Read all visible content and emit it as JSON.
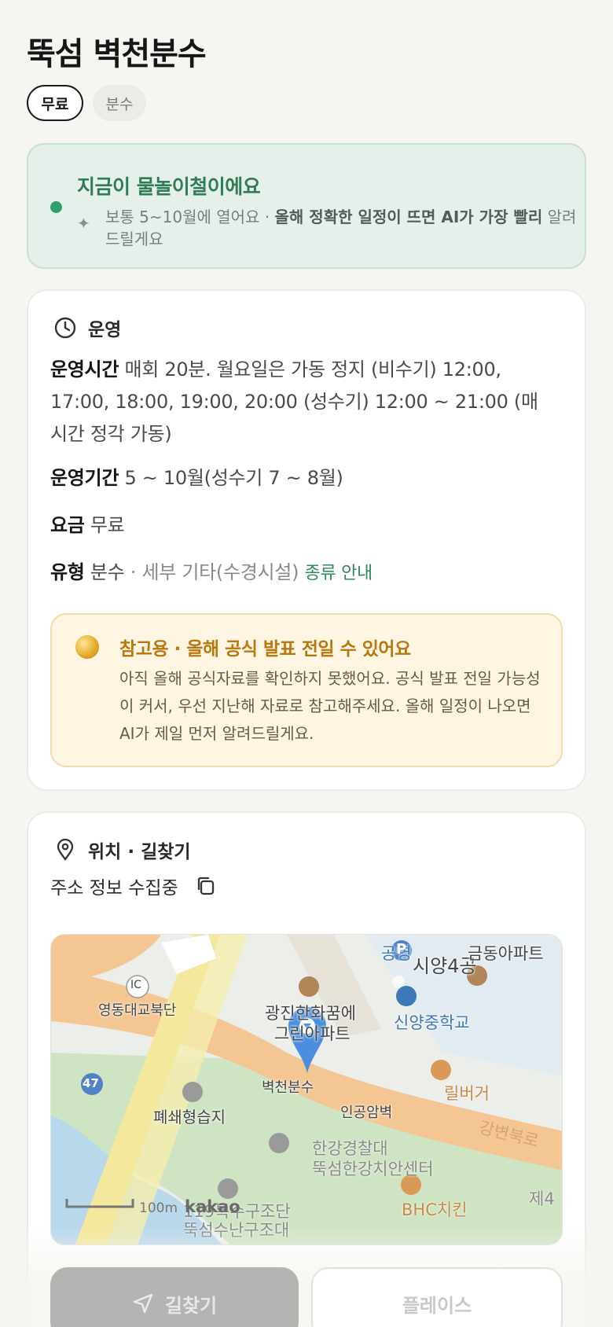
{
  "page": {
    "title": "뚝섬 벽천분수"
  },
  "chips": [
    {
      "label": "무료",
      "selected": true
    },
    {
      "label": "분수",
      "selected": false
    }
  ],
  "season": {
    "heading": "지금이 물놀이철이에요",
    "note_prefix": "보통 5~10월에 열어요 · ",
    "note_bold": "올해 정확한 일정이 뜨면 AI가 가장 빨리",
    "note_suffix": " 알려드릴게요",
    "accent": "#2ea06a"
  },
  "ops": {
    "heading": "운영",
    "hours_key": "운영시간",
    "hours_value": "매회 20분. 월요일은 가동 정지 (비수기) 12:00, 17:00, 18:00, 19:00, 20:00 (성수기) 12:00 ~ 21:00 (매시간 정각 가동)",
    "period_key": "운영기간",
    "period_value": "5 ~ 10월(성수기 7 ~ 8월)",
    "fee_key": "요금",
    "fee_value": "무료",
    "type_key": "유형",
    "type_value": "분수",
    "type_sub": " · 세부 기타(수경시설)",
    "type_link": "종류 안내",
    "notice_heading": "참고용 · 올해 공식 발표 전일 수 있어요",
    "notice_body": "아직 올해 공식자료를 확인하지 못했어요. 공식 발표 전일 가능성이 커서, 우선 지난해 자료로 참고해주세요. 올해 일정이 나오면 AI가 제일 먼저 알려드릴게요."
  },
  "location": {
    "heading": "위치 · 길찾기",
    "address": "주소 정보 수집중",
    "map": {
      "labels": {
        "ic": "IC",
        "yeongdong": "영동대교북단",
        "route47": "47",
        "wetland": "폐쇄형습지",
        "gwangjin": "광진한화꿈에",
        "gwangjin2": "그린아파트",
        "marker": "벽천분수",
        "rockwall": "인공암벽",
        "police": "한강경찰대",
        "police2": "뚝섬한강치안센터",
        "rescue": "119특수구조단",
        "rescue2": "뚝섬수난구조대",
        "park": "공영",
        "parking": "P",
        "siyang": "시양4공",
        "geumdong": "금동아파트",
        "school": "신양중학교",
        "burger": "릴버거",
        "road": "강변북로",
        "bhc": "BHC치킨",
        "je4": "제4",
        "scale": "100m",
        "brand": "kakao"
      }
    }
  },
  "actions": {
    "route": "길찾기",
    "place": "플레이스"
  }
}
